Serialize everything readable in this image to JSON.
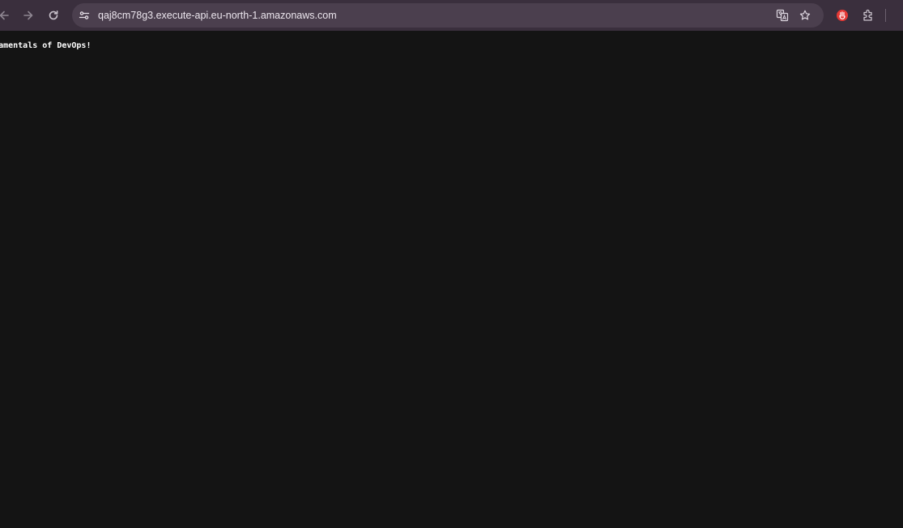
{
  "browser": {
    "url": "qaj8cm78g3.execute-api.eu-north-1.amazonaws.com",
    "colors": {
      "toolbar": "#3a2f3d",
      "omnibox": "#4b3f4e",
      "page_background": "#141414",
      "page_text": "#ffffff",
      "extension_accent": "#e53935"
    },
    "icons": {
      "back": "back-arrow-icon",
      "forward": "forward-arrow-icon",
      "reload": "reload-icon",
      "site_info": "tune-icon",
      "translate": "translate-icon",
      "bookmark": "star-icon",
      "extension": "red-extension-icon",
      "extensions_menu": "puzzle-icon"
    }
  },
  "page": {
    "text": "Fundamentals of DevOps!"
  }
}
